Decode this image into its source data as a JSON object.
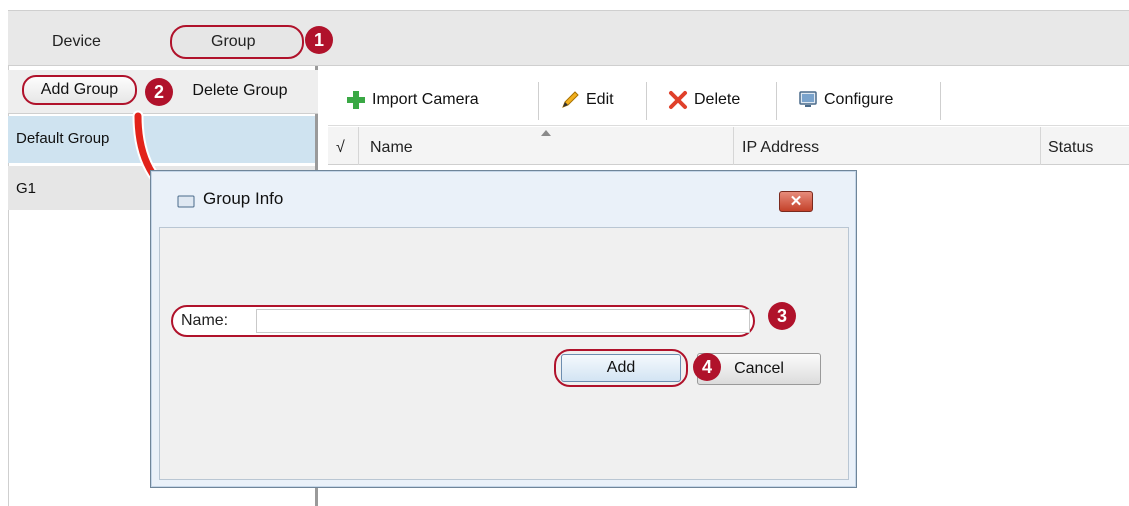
{
  "top_tabs": {
    "device": "Device",
    "group": "Group"
  },
  "left_panel": {
    "add_group": "Add Group",
    "delete_group": "Delete Group",
    "groups": [
      "Default Group",
      "G1"
    ]
  },
  "toolbar": {
    "import_camera": "Import Camera",
    "edit": "Edit",
    "delete": "Delete",
    "configure": "Configure"
  },
  "table": {
    "check_header": "√",
    "columns": [
      "Name",
      "IP Address",
      "Status"
    ]
  },
  "dialog": {
    "title": "Group Info",
    "close_glyph": "✕",
    "name_label": "Name:",
    "name_value": "",
    "add_button": "Add",
    "cancel_button": "Cancel"
  },
  "callouts": [
    "1",
    "2",
    "3",
    "4"
  ],
  "colors": {
    "accent_red": "#b0122b",
    "selected_row": "#cfe3f0",
    "arrow_red": "#e2231a"
  },
  "icons": {
    "import": "plus-icon",
    "edit": "pencil-icon",
    "delete": "x-icon",
    "configure": "monitor-icon",
    "dialog": "group-info-icon"
  }
}
